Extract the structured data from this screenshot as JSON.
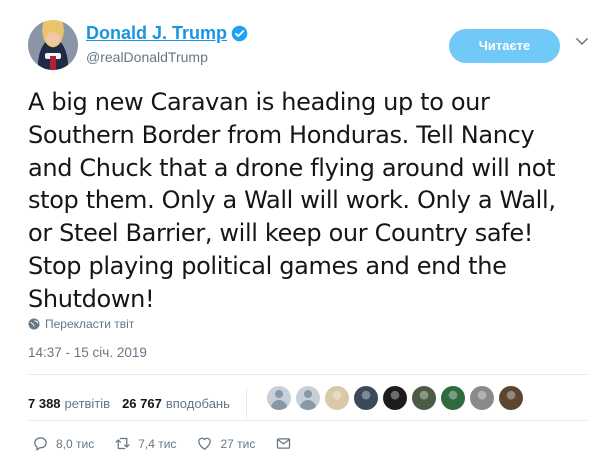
{
  "author": {
    "display_name": "Donald J. Trump",
    "handle": "@realDonaldTrump",
    "verified": true
  },
  "follow_button": {
    "label": "Читаєте"
  },
  "tweet": {
    "text": "A big new Caravan is heading up to our\nSouthern Border from Honduras. Tell Nancy\nand Chuck that a drone flying around will not\nstop them. Only a Wall will work. Only a Wall,\nor Steel Barrier, will keep our Country safe!\nStop playing political games and end the\nShutdown!",
    "translate_label": "Перекласти твіт",
    "timestamp": "14:37 - 15 січ. 2019"
  },
  "stats": {
    "retweets_count": "7 388",
    "retweets_label": "ретвітів",
    "likes_count": "26 767",
    "likes_label": "вподобань"
  },
  "likers": [
    {
      "icon": "default-avatar"
    },
    {
      "icon": "default-avatar"
    },
    {
      "icon": "user-avatar",
      "color": "#d9c9a8"
    },
    {
      "icon": "user-avatar",
      "color": "#3a4a5c"
    },
    {
      "icon": "user-avatar",
      "color": "#1c1c1c"
    },
    {
      "icon": "user-avatar",
      "color": "#4a5d44"
    },
    {
      "icon": "user-avatar",
      "color": "#2f6b3c"
    },
    {
      "icon": "user-avatar",
      "color": "#8a8a8a"
    },
    {
      "icon": "user-avatar",
      "color": "#5c4632"
    }
  ],
  "actions": {
    "replies": "8,0 тис",
    "retweets": "7,4 тис",
    "likes": "27 тис"
  },
  "colors": {
    "accent": "#1b95e0",
    "follow_button": "#71c9f8",
    "muted": "#657786",
    "text": "#14171a"
  }
}
